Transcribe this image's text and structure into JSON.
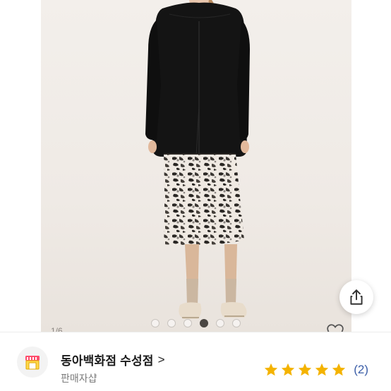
{
  "product_image": {
    "pager": {
      "total": 6,
      "active_index": 3
    },
    "page_counter": "1/6"
  },
  "seller": {
    "name": "동아백화점 수성점",
    "chevron": ">",
    "subtitle": "판매자샵",
    "rating": 5,
    "rating_max": 5,
    "review_count": "(2)"
  },
  "colors": {
    "star": "#f4b300",
    "review_count": "#3b5ea8",
    "avatar_store": "#ff4d6d"
  },
  "icons": {
    "share": "share-icon",
    "like": "heart-icon",
    "avatar": "storefront-icon",
    "star": "star-icon"
  }
}
